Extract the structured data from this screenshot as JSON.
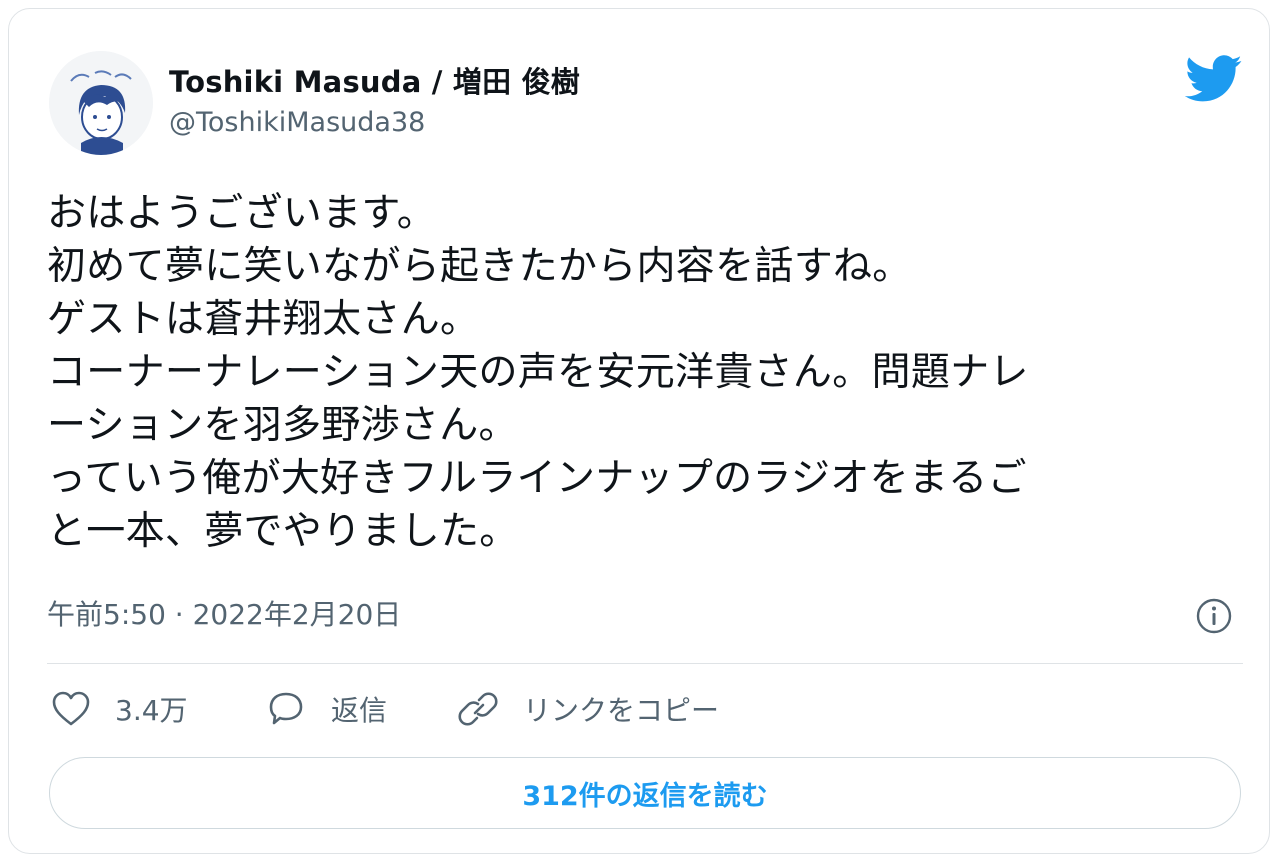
{
  "author": {
    "display_name": "Toshiki Masuda / 増田 俊樹",
    "handle": "@ToshikiMasuda38",
    "avatar": "avatar-illustration"
  },
  "tweet": {
    "text": "おはようございます。\n初めて夢に笑いながら起きたから内容を話すね。\nゲストは蒼井翔太さん。\nコーナーナレーション天の声を安元洋貴さん。問題ナレ\nーションを羽多野渉さん。\nっていう俺が大好きフルラインナップのラジオをまるご\nと一本、夢でやりました。",
    "timestamp": "午前5:50 · 2022年2月20日"
  },
  "actions": {
    "like_count": "3.4万",
    "reply_label": "返信",
    "copy_link_label": "リンクをコピー",
    "read_replies_label": "312件の返信を読む"
  },
  "icons": {
    "brand": "twitter-bird-icon",
    "info": "info-icon",
    "like": "heart-icon",
    "reply": "speech-bubble-icon",
    "link": "link-icon"
  },
  "colors": {
    "brand_blue": "#1d9bf0",
    "secondary_text": "#536471",
    "border": "#dfe3e6"
  }
}
